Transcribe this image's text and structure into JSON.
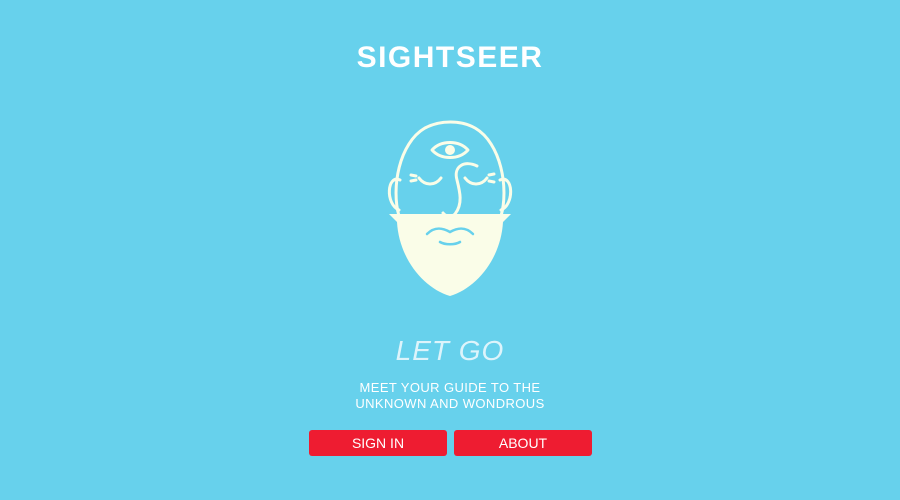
{
  "header": {
    "title": "SIGHTSEER"
  },
  "logo": {
    "icon": "bearded-face-third-eye-icon",
    "color": "#fafde8"
  },
  "hero": {
    "tagline": "LET GO",
    "subtitle_line1": "MEET YOUR GUIDE TO THE",
    "subtitle_line2": "UNKNOWN AND WONDROUS"
  },
  "actions": {
    "sign_in_label": "SIGN IN",
    "about_label": "ABOUT"
  },
  "colors": {
    "background": "#67d1ec",
    "button": "#ee1c31",
    "text": "#ffffff"
  }
}
